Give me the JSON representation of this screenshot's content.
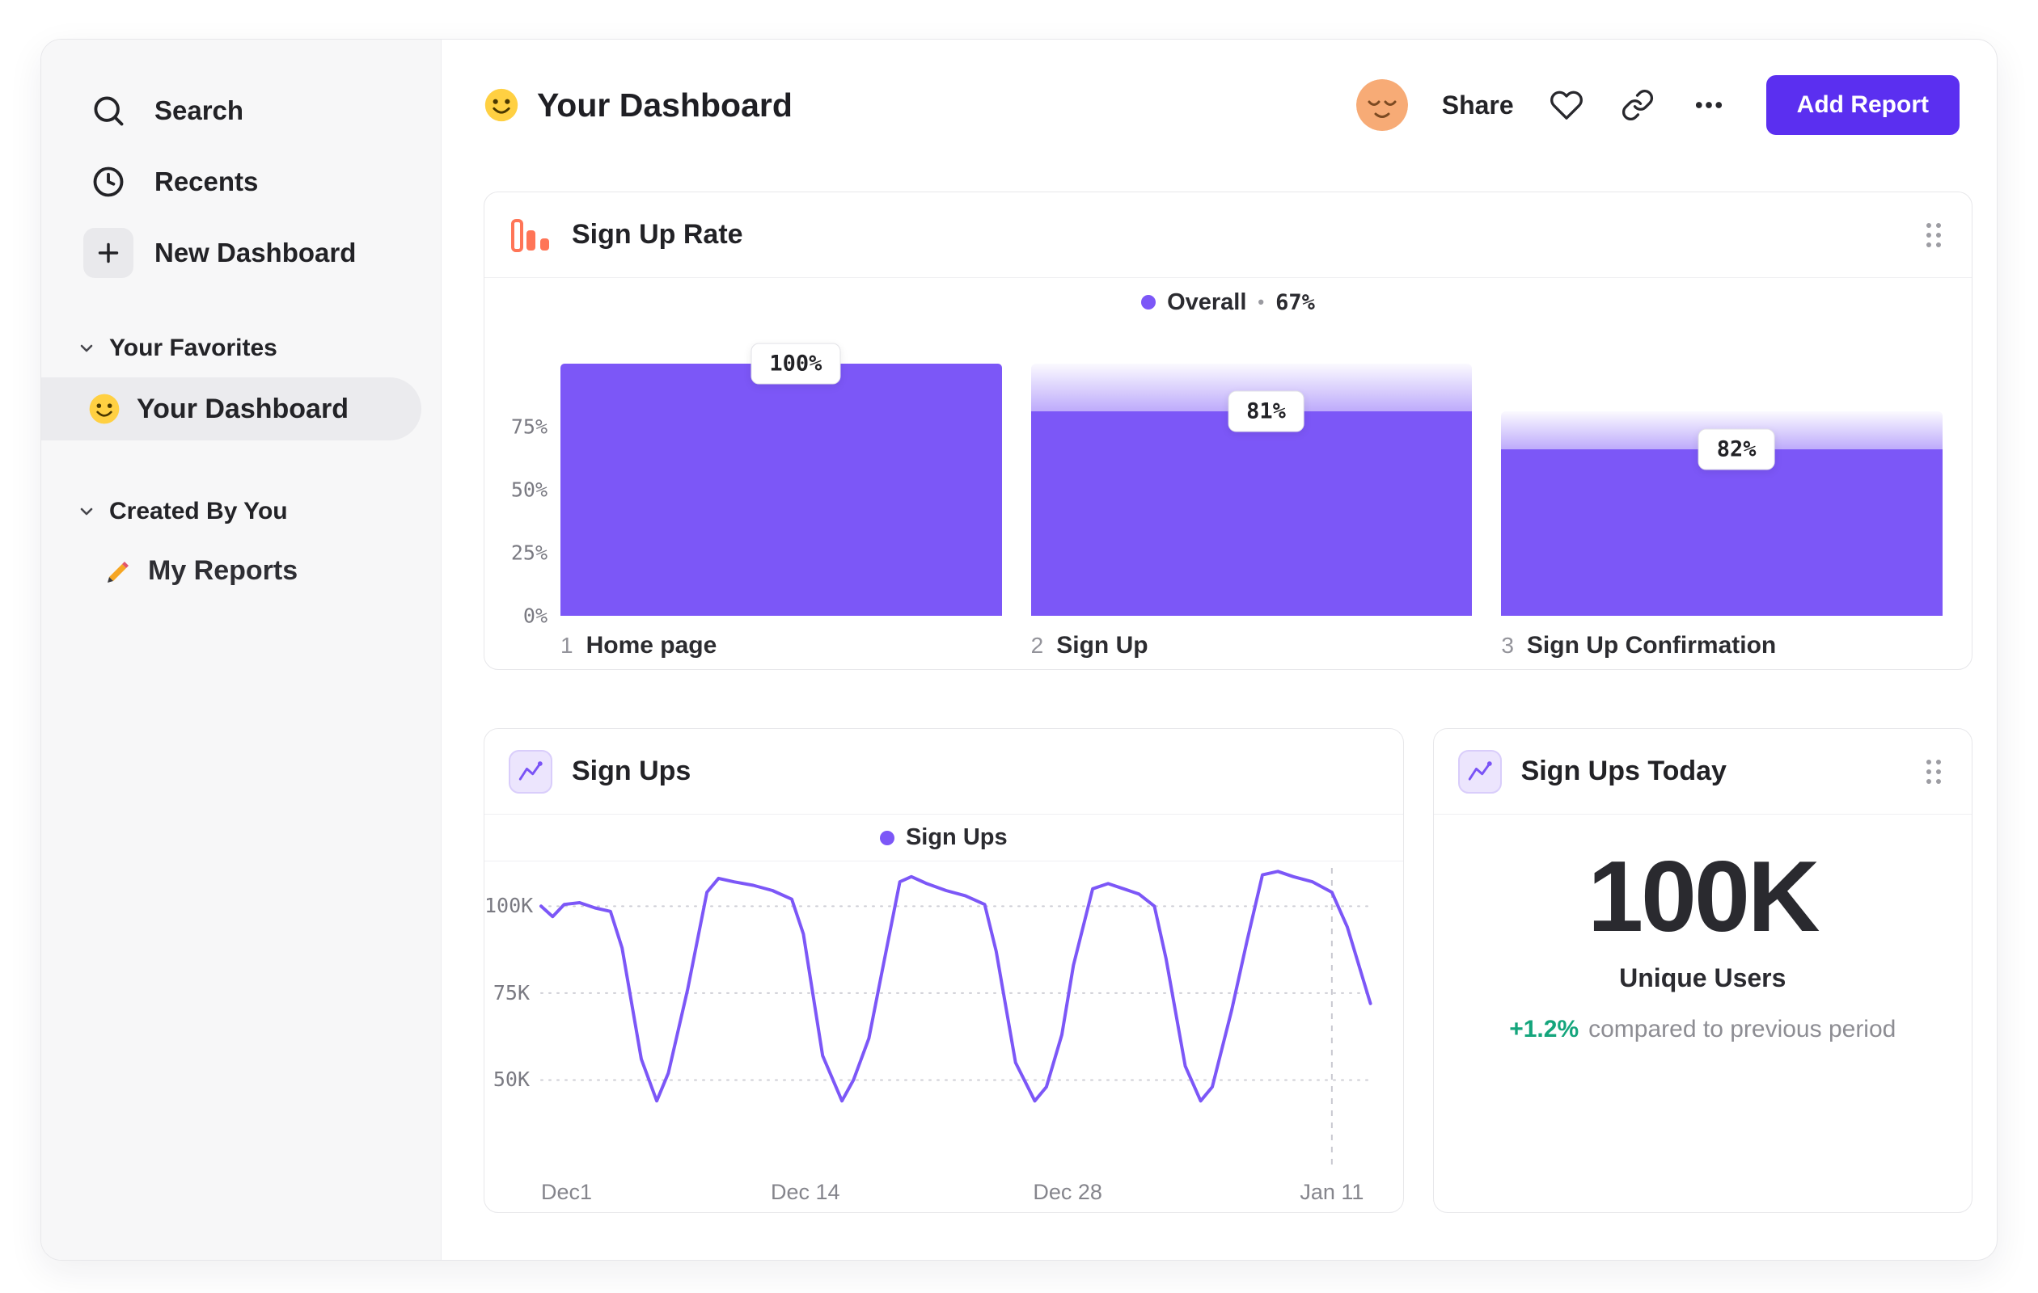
{
  "window": {
    "title": "Your Dashboard"
  },
  "sidebar": {
    "nav": [
      {
        "label": "Search",
        "icon": "search-icon"
      },
      {
        "label": "Recents",
        "icon": "clock-icon"
      },
      {
        "label": "New Dashboard",
        "icon": "plus-icon"
      }
    ],
    "sections": [
      {
        "label": "Your Favorites",
        "items": [
          {
            "label": "Your Dashboard",
            "icon": "smiley-emoji",
            "selected": true
          }
        ]
      },
      {
        "label": "Created By You",
        "items": [
          {
            "label": "My Reports",
            "icon": "pencil-emoji",
            "selected": false
          }
        ]
      }
    ]
  },
  "header": {
    "title": "Your Dashboard",
    "title_icon": "smiley-emoji",
    "avatar_icon": "relieved-face-emoji",
    "share_label": "Share",
    "icons": [
      "heart-icon",
      "link-icon",
      "more-icon"
    ],
    "add_report_label": "Add Report"
  },
  "colors": {
    "accent_purple": "#7c57f7",
    "button_purple": "#5b2ff0",
    "orange": "#ff7557",
    "green": "#14a57c",
    "sidebar_bg": "#f7f7f8",
    "selected_bg": "#ebebee",
    "text": "#232327",
    "text_gray": "#8c8c92",
    "border": "#e7e7ea"
  },
  "chart_data": [
    {
      "type": "bar",
      "variant": "funnel",
      "title": "Sign Up Rate",
      "legend": {
        "label": "Overall",
        "separator": "•",
        "value": "67%"
      },
      "steps": [
        {
          "number": "1",
          "name": "Home page",
          "display_value": "100%",
          "bar_percent": 100,
          "ghost_percent": 100
        },
        {
          "number": "2",
          "name": "Sign Up",
          "display_value": "81%",
          "bar_percent": 81,
          "ghost_percent": 100
        },
        {
          "number": "3",
          "name": "Sign Up Confirmation",
          "display_value": "82%",
          "bar_percent": 66,
          "ghost_percent": 81
        }
      ],
      "y_ticks": [
        {
          "label": "75%",
          "value": 75
        },
        {
          "label": "50%",
          "value": 50
        },
        {
          "label": "25%",
          "value": 25
        },
        {
          "label": "0%",
          "value": 0
        }
      ],
      "ylim": [
        0,
        100
      ],
      "grid": false,
      "legend_position": "top-center"
    },
    {
      "type": "line",
      "title": "Sign Ups",
      "legend": {
        "label": "Sign Ups"
      },
      "unit": "K",
      "y_ticks": [
        {
          "label": "100K",
          "value": 100
        },
        {
          "label": "75K",
          "value": 75
        },
        {
          "label": "50K",
          "value": 50
        }
      ],
      "x_ticks": [
        {
          "label": "Dec1",
          "day": 0
        },
        {
          "label": "Dec 14",
          "day": 13.7
        },
        {
          "label": "Dec 28",
          "day": 27.3
        },
        {
          "label": "Jan 11",
          "day": 41
        }
      ],
      "x_domain_days": [
        0,
        43
      ],
      "y_domain": [
        25,
        111
      ],
      "dashed_vline_day": 41,
      "grid": "dotted-horizontal",
      "legend_position": "top-center",
      "points": [
        [
          0,
          100
        ],
        [
          0.6,
          97
        ],
        [
          1.2,
          100.5
        ],
        [
          2,
          101
        ],
        [
          2.8,
          99.5
        ],
        [
          3.6,
          98.5
        ],
        [
          4.2,
          88
        ],
        [
          5.2,
          56
        ],
        [
          6,
          44
        ],
        [
          6.6,
          52
        ],
        [
          7.6,
          76
        ],
        [
          8.6,
          104
        ],
        [
          9.2,
          108
        ],
        [
          10,
          107
        ],
        [
          11,
          106
        ],
        [
          12,
          104.5
        ],
        [
          13,
          102
        ],
        [
          13.6,
          92
        ],
        [
          14.6,
          57
        ],
        [
          15.6,
          44
        ],
        [
          16.2,
          50
        ],
        [
          17,
          62
        ],
        [
          17.6,
          79
        ],
        [
          18.6,
          107
        ],
        [
          19.2,
          108.5
        ],
        [
          20,
          106.5
        ],
        [
          21,
          104.5
        ],
        [
          22,
          103
        ],
        [
          23,
          100.5
        ],
        [
          23.6,
          87
        ],
        [
          24.6,
          55
        ],
        [
          25.6,
          44
        ],
        [
          26.2,
          48
        ],
        [
          27,
          63
        ],
        [
          27.6,
          83
        ],
        [
          28.6,
          105
        ],
        [
          29.4,
          106.5
        ],
        [
          30.2,
          105
        ],
        [
          31,
          103.5
        ],
        [
          31.8,
          100
        ],
        [
          32.4,
          85
        ],
        [
          33.4,
          54
        ],
        [
          34.2,
          44
        ],
        [
          34.8,
          48
        ],
        [
          35.8,
          70
        ],
        [
          36.6,
          90
        ],
        [
          37.4,
          109
        ],
        [
          38.2,
          110
        ],
        [
          39,
          108.5
        ],
        [
          40,
          107
        ],
        [
          41,
          104
        ],
        [
          41.8,
          94
        ],
        [
          43,
          72
        ]
      ]
    },
    {
      "type": "big_number",
      "title": "Sign Ups Today",
      "value": "100K",
      "label": "Unique Users",
      "delta": "+1.2%",
      "delta_note": "compared to previous period"
    }
  ]
}
